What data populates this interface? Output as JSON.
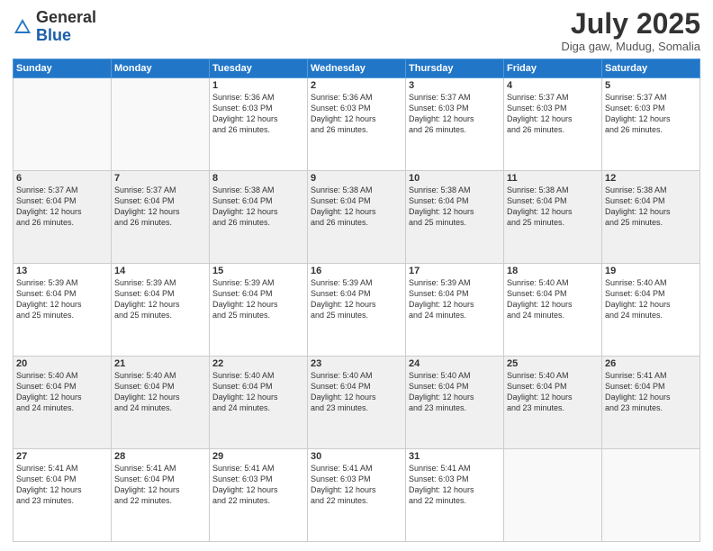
{
  "logo": {
    "general": "General",
    "blue": "Blue"
  },
  "title": "July 2025",
  "location": "Diga gaw, Mudug, Somalia",
  "days_of_week": [
    "Sunday",
    "Monday",
    "Tuesday",
    "Wednesday",
    "Thursday",
    "Friday",
    "Saturday"
  ],
  "weeks": [
    {
      "shaded": false,
      "days": [
        {
          "num": "",
          "data": ""
        },
        {
          "num": "",
          "data": ""
        },
        {
          "num": "1",
          "data": "Sunrise: 5:36 AM\nSunset: 6:03 PM\nDaylight: 12 hours\nand 26 minutes."
        },
        {
          "num": "2",
          "data": "Sunrise: 5:36 AM\nSunset: 6:03 PM\nDaylight: 12 hours\nand 26 minutes."
        },
        {
          "num": "3",
          "data": "Sunrise: 5:37 AM\nSunset: 6:03 PM\nDaylight: 12 hours\nand 26 minutes."
        },
        {
          "num": "4",
          "data": "Sunrise: 5:37 AM\nSunset: 6:03 PM\nDaylight: 12 hours\nand 26 minutes."
        },
        {
          "num": "5",
          "data": "Sunrise: 5:37 AM\nSunset: 6:03 PM\nDaylight: 12 hours\nand 26 minutes."
        }
      ]
    },
    {
      "shaded": true,
      "days": [
        {
          "num": "6",
          "data": "Sunrise: 5:37 AM\nSunset: 6:04 PM\nDaylight: 12 hours\nand 26 minutes."
        },
        {
          "num": "7",
          "data": "Sunrise: 5:37 AM\nSunset: 6:04 PM\nDaylight: 12 hours\nand 26 minutes."
        },
        {
          "num": "8",
          "data": "Sunrise: 5:38 AM\nSunset: 6:04 PM\nDaylight: 12 hours\nand 26 minutes."
        },
        {
          "num": "9",
          "data": "Sunrise: 5:38 AM\nSunset: 6:04 PM\nDaylight: 12 hours\nand 26 minutes."
        },
        {
          "num": "10",
          "data": "Sunrise: 5:38 AM\nSunset: 6:04 PM\nDaylight: 12 hours\nand 25 minutes."
        },
        {
          "num": "11",
          "data": "Sunrise: 5:38 AM\nSunset: 6:04 PM\nDaylight: 12 hours\nand 25 minutes."
        },
        {
          "num": "12",
          "data": "Sunrise: 5:38 AM\nSunset: 6:04 PM\nDaylight: 12 hours\nand 25 minutes."
        }
      ]
    },
    {
      "shaded": false,
      "days": [
        {
          "num": "13",
          "data": "Sunrise: 5:39 AM\nSunset: 6:04 PM\nDaylight: 12 hours\nand 25 minutes."
        },
        {
          "num": "14",
          "data": "Sunrise: 5:39 AM\nSunset: 6:04 PM\nDaylight: 12 hours\nand 25 minutes."
        },
        {
          "num": "15",
          "data": "Sunrise: 5:39 AM\nSunset: 6:04 PM\nDaylight: 12 hours\nand 25 minutes."
        },
        {
          "num": "16",
          "data": "Sunrise: 5:39 AM\nSunset: 6:04 PM\nDaylight: 12 hours\nand 25 minutes."
        },
        {
          "num": "17",
          "data": "Sunrise: 5:39 AM\nSunset: 6:04 PM\nDaylight: 12 hours\nand 24 minutes."
        },
        {
          "num": "18",
          "data": "Sunrise: 5:40 AM\nSunset: 6:04 PM\nDaylight: 12 hours\nand 24 minutes."
        },
        {
          "num": "19",
          "data": "Sunrise: 5:40 AM\nSunset: 6:04 PM\nDaylight: 12 hours\nand 24 minutes."
        }
      ]
    },
    {
      "shaded": true,
      "days": [
        {
          "num": "20",
          "data": "Sunrise: 5:40 AM\nSunset: 6:04 PM\nDaylight: 12 hours\nand 24 minutes."
        },
        {
          "num": "21",
          "data": "Sunrise: 5:40 AM\nSunset: 6:04 PM\nDaylight: 12 hours\nand 24 minutes."
        },
        {
          "num": "22",
          "data": "Sunrise: 5:40 AM\nSunset: 6:04 PM\nDaylight: 12 hours\nand 24 minutes."
        },
        {
          "num": "23",
          "data": "Sunrise: 5:40 AM\nSunset: 6:04 PM\nDaylight: 12 hours\nand 23 minutes."
        },
        {
          "num": "24",
          "data": "Sunrise: 5:40 AM\nSunset: 6:04 PM\nDaylight: 12 hours\nand 23 minutes."
        },
        {
          "num": "25",
          "data": "Sunrise: 5:40 AM\nSunset: 6:04 PM\nDaylight: 12 hours\nand 23 minutes."
        },
        {
          "num": "26",
          "data": "Sunrise: 5:41 AM\nSunset: 6:04 PM\nDaylight: 12 hours\nand 23 minutes."
        }
      ]
    },
    {
      "shaded": false,
      "days": [
        {
          "num": "27",
          "data": "Sunrise: 5:41 AM\nSunset: 6:04 PM\nDaylight: 12 hours\nand 23 minutes."
        },
        {
          "num": "28",
          "data": "Sunrise: 5:41 AM\nSunset: 6:04 PM\nDaylight: 12 hours\nand 22 minutes."
        },
        {
          "num": "29",
          "data": "Sunrise: 5:41 AM\nSunset: 6:03 PM\nDaylight: 12 hours\nand 22 minutes."
        },
        {
          "num": "30",
          "data": "Sunrise: 5:41 AM\nSunset: 6:03 PM\nDaylight: 12 hours\nand 22 minutes."
        },
        {
          "num": "31",
          "data": "Sunrise: 5:41 AM\nSunset: 6:03 PM\nDaylight: 12 hours\nand 22 minutes."
        },
        {
          "num": "",
          "data": ""
        },
        {
          "num": "",
          "data": ""
        }
      ]
    }
  ]
}
